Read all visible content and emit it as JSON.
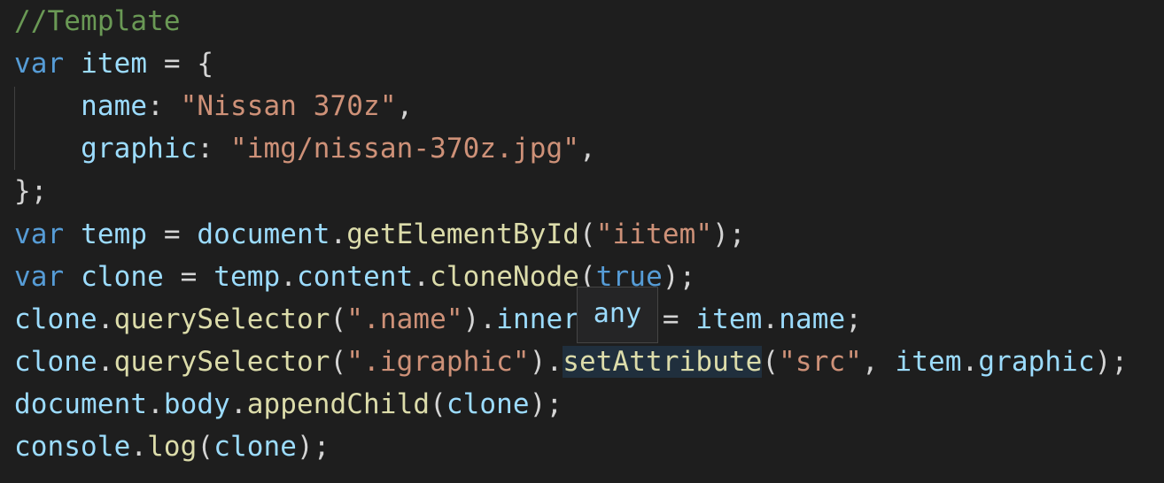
{
  "editor": {
    "lines": [
      [
        {
          "t": "//Template",
          "c": "cmt"
        }
      ],
      [
        {
          "t": "var",
          "c": "kw"
        },
        {
          "t": " ",
          "c": "pun"
        },
        {
          "t": "item",
          "c": "var"
        },
        {
          "t": " = {",
          "c": "pun"
        }
      ],
      [
        {
          "t": "    ",
          "c": "pun"
        },
        {
          "t": "name",
          "c": "var"
        },
        {
          "t": ": ",
          "c": "pun"
        },
        {
          "t": "\"Nissan 370z\"",
          "c": "str"
        },
        {
          "t": ",",
          "c": "pun"
        }
      ],
      [
        {
          "t": "    ",
          "c": "pun"
        },
        {
          "t": "graphic",
          "c": "var"
        },
        {
          "t": ": ",
          "c": "pun"
        },
        {
          "t": "\"img/nissan-370z.jpg\"",
          "c": "str"
        },
        {
          "t": ",",
          "c": "pun"
        }
      ],
      [
        {
          "t": "};",
          "c": "pun"
        }
      ],
      [
        {
          "t": "var",
          "c": "kw"
        },
        {
          "t": " ",
          "c": "pun"
        },
        {
          "t": "temp",
          "c": "var"
        },
        {
          "t": " = ",
          "c": "pun"
        },
        {
          "t": "document",
          "c": "var"
        },
        {
          "t": ".",
          "c": "pun"
        },
        {
          "t": "getElementById",
          "c": "fn"
        },
        {
          "t": "(",
          "c": "pun"
        },
        {
          "t": "\"iitem\"",
          "c": "str"
        },
        {
          "t": ");",
          "c": "pun"
        }
      ],
      [
        {
          "t": "var",
          "c": "kw"
        },
        {
          "t": " ",
          "c": "pun"
        },
        {
          "t": "clone",
          "c": "var"
        },
        {
          "t": " = ",
          "c": "pun"
        },
        {
          "t": "temp",
          "c": "var"
        },
        {
          "t": ".",
          "c": "pun"
        },
        {
          "t": "content",
          "c": "var"
        },
        {
          "t": ".",
          "c": "pun"
        },
        {
          "t": "cloneNode",
          "c": "fn"
        },
        {
          "t": "(",
          "c": "pun"
        },
        {
          "t": "true",
          "c": "kw"
        },
        {
          "t": ");",
          "c": "pun"
        }
      ],
      [
        {
          "t": "clone",
          "c": "var"
        },
        {
          "t": ".",
          "c": "pun"
        },
        {
          "t": "querySelector",
          "c": "fn"
        },
        {
          "t": "(",
          "c": "pun"
        },
        {
          "t": "\".name\"",
          "c": "str"
        },
        {
          "t": ").",
          "c": "pun"
        },
        {
          "t": "innerHTML",
          "c": "var"
        },
        {
          "t": " = ",
          "c": "pun"
        },
        {
          "t": "item",
          "c": "var"
        },
        {
          "t": ".",
          "c": "pun"
        },
        {
          "t": "name",
          "c": "var"
        },
        {
          "t": ";",
          "c": "pun"
        }
      ],
      [
        {
          "t": "clone",
          "c": "var"
        },
        {
          "t": ".",
          "c": "pun"
        },
        {
          "t": "querySelector",
          "c": "fn"
        },
        {
          "t": "(",
          "c": "pun"
        },
        {
          "t": "\".igraphic\"",
          "c": "str"
        },
        {
          "t": ").",
          "c": "pun"
        },
        {
          "t": "setAttribute",
          "c": "fn hl"
        },
        {
          "t": "(",
          "c": "pun"
        },
        {
          "t": "\"src\"",
          "c": "str"
        },
        {
          "t": ", ",
          "c": "pun"
        },
        {
          "t": "item",
          "c": "var"
        },
        {
          "t": ".",
          "c": "pun"
        },
        {
          "t": "graphic",
          "c": "var"
        },
        {
          "t": ");",
          "c": "pun"
        }
      ],
      [
        {
          "t": "document",
          "c": "var"
        },
        {
          "t": ".",
          "c": "pun"
        },
        {
          "t": "body",
          "c": "var"
        },
        {
          "t": ".",
          "c": "pun"
        },
        {
          "t": "appendChild",
          "c": "fn"
        },
        {
          "t": "(",
          "c": "pun"
        },
        {
          "t": "clone",
          "c": "var"
        },
        {
          "t": ");",
          "c": "pun"
        }
      ],
      [
        {
          "t": "console",
          "c": "var"
        },
        {
          "t": ".",
          "c": "pun"
        },
        {
          "t": "log",
          "c": "fn"
        },
        {
          "t": "(",
          "c": "pun"
        },
        {
          "t": "clone",
          "c": "var"
        },
        {
          "t": ");",
          "c": "pun"
        }
      ]
    ]
  },
  "hover_tooltip": {
    "text": "any"
  },
  "colors": {
    "background": "#1e1e1e",
    "keyword": "#569cd6",
    "variable": "#9cdcfe",
    "function": "#dcdcaa",
    "string": "#ce9178",
    "punctuation": "#d4d4d4",
    "comment": "#6a9955"
  }
}
